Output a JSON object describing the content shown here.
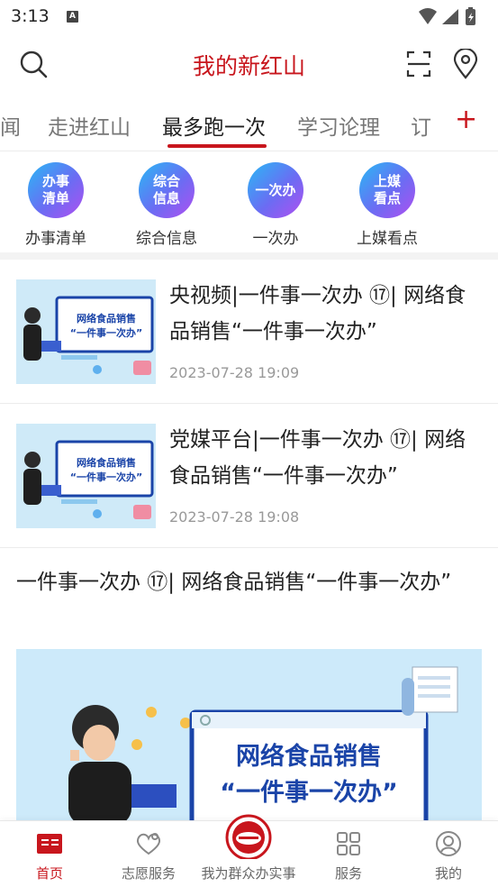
{
  "status": {
    "time": "3:13",
    "notification_badge": "A"
  },
  "header": {
    "title": "我的新红山",
    "icons": [
      "search-icon",
      "scan-icon",
      "location-icon"
    ]
  },
  "tabs": [
    {
      "label": "闻"
    },
    {
      "label": "走进红山"
    },
    {
      "label": "最多跑一次",
      "active": true
    },
    {
      "label": "学习论理"
    },
    {
      "label": "订"
    }
  ],
  "tabs_add": "+",
  "quick": [
    {
      "icon_text": "办事清单",
      "label": "办事清单"
    },
    {
      "icon_text": "综合信息",
      "label": "综合信息"
    },
    {
      "icon_text": "一次办",
      "label": "一次办"
    },
    {
      "icon_text": "上媒看点",
      "label": "上媒看点"
    }
  ],
  "news": [
    {
      "title": "央视频|一件事一次办 ⑰| 网络食品销售“一件事一次办”",
      "date": "2023-07-28 19:09",
      "thumb_line1": "网络食品销售",
      "thumb_line2": "“一件事一次办”"
    },
    {
      "title": "党媒平台|一件事一次办 ⑰| 网络食品销售“一件事一次办”",
      "date": "2023-07-28 19:08",
      "thumb_line1": "网络食品销售",
      "thumb_line2": "“一件事一次办”"
    }
  ],
  "featured": {
    "title": "一件事一次办 ⑰| 网络食品销售“一件事一次办”",
    "image_line1": "网络食品销售",
    "image_line2": "“一件事一次办”"
  },
  "tabbar": [
    {
      "label": "首页",
      "icon": "home-icon",
      "active": true
    },
    {
      "label": "志愿服务",
      "icon": "volunteer-icon"
    },
    {
      "label": "我为群众办实事",
      "icon": "logo-icon"
    },
    {
      "label": "服务",
      "icon": "grid-icon"
    },
    {
      "label": "我的",
      "icon": "profile-icon"
    }
  ],
  "colors": {
    "brand_red": "#c8161d",
    "thumb_blue": "#1a44a8",
    "gradient_start": "#28b9f5",
    "gradient_end": "#b04ff0"
  }
}
